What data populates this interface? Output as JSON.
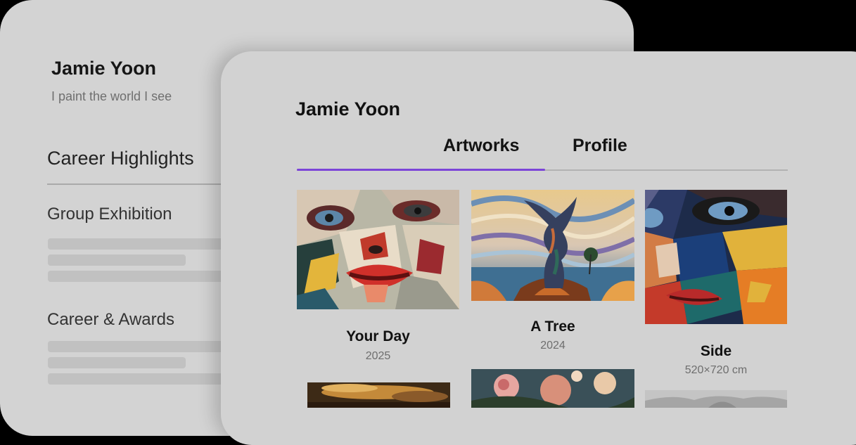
{
  "back_card": {
    "artist_name": "Jamie Yoon",
    "tagline": "I paint the world I see",
    "section_title": "Career Highlights",
    "subsections": [
      "Group Exhibition",
      "Career & Awards"
    ]
  },
  "front_card": {
    "artist_name": "Jamie Yoon",
    "tabs": [
      {
        "label": "Artworks",
        "active": true
      },
      {
        "label": "Profile",
        "active": false
      }
    ],
    "artworks": [
      {
        "title": "Your Day",
        "subtitle": "2025",
        "image": "abstract-face-painting"
      },
      {
        "title": "A Tree",
        "subtitle": "2024",
        "image": "surreal-tree-painting"
      },
      {
        "title": "Side",
        "subtitle": "520×720 cm",
        "image": "abstract-face-side-painting"
      }
    ],
    "partial_thumbnails": [
      "sunset-sky-painting",
      "flower-painting",
      "grey-landscape-painting"
    ]
  },
  "colors": {
    "accent": "#7c45d8",
    "card_background": "#d3d3d3",
    "page_background": "#000000"
  }
}
